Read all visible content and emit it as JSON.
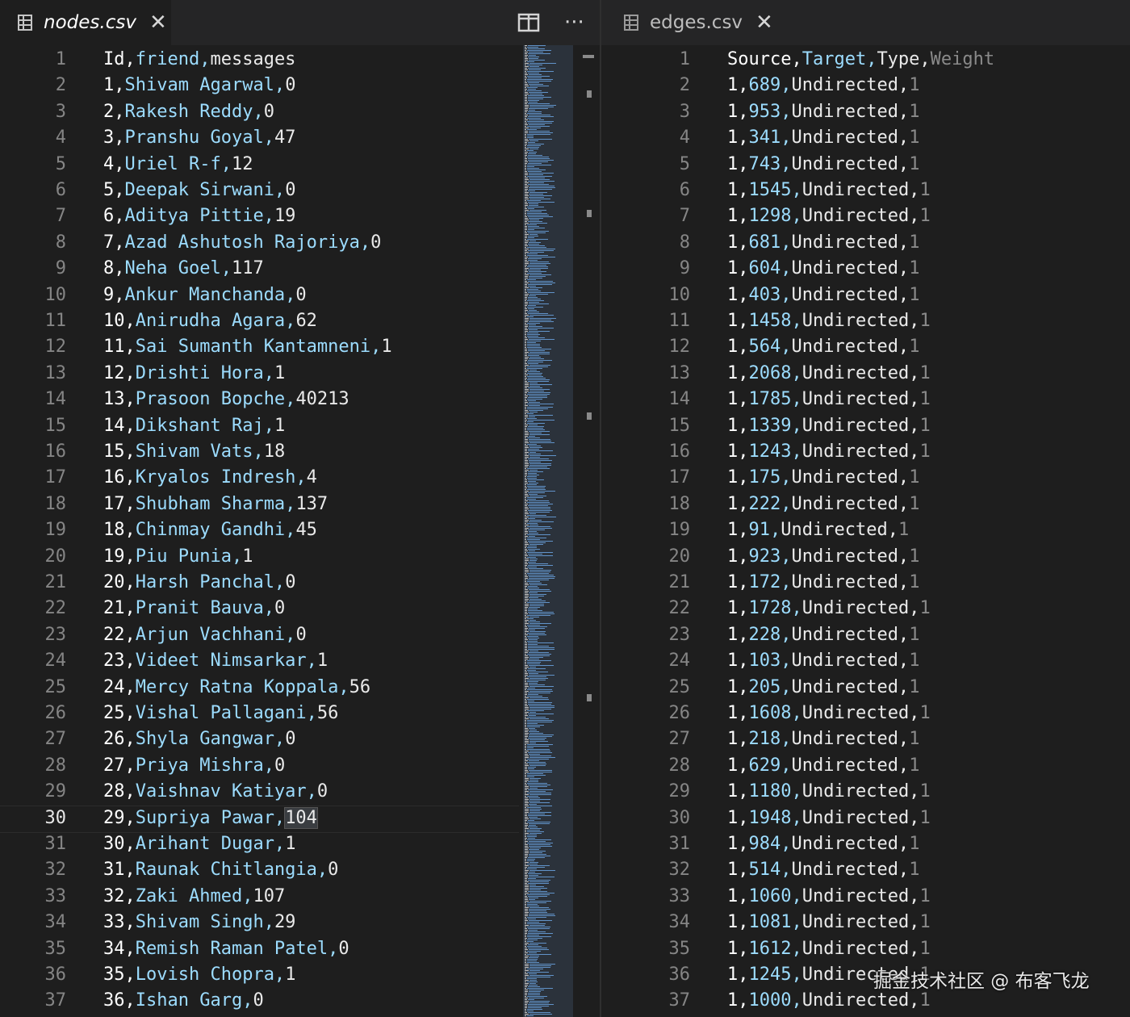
{
  "left_editor": {
    "tab": {
      "title": "nodes.csv",
      "close_glyph": "✕",
      "icon": "table-file-icon"
    },
    "actions": {
      "split_icon": "split-editor-icon",
      "more_glyph": "···"
    },
    "current_line_index": 29,
    "lines": [
      [
        "Id,",
        "friend,",
        "messages",
        ""
      ],
      [
        "1,",
        "Shivam Agarwal,",
        "0",
        ""
      ],
      [
        "2,",
        "Rakesh Reddy,",
        "0",
        ""
      ],
      [
        "3,",
        "Pranshu Goyal,",
        "47",
        ""
      ],
      [
        "4,",
        "Uriel R-f,",
        "12",
        ""
      ],
      [
        "5,",
        "Deepak Sirwani,",
        "0",
        ""
      ],
      [
        "6,",
        "Aditya Pittie,",
        "19",
        ""
      ],
      [
        "7,",
        "Azad Ashutosh Rajoriya,",
        "0",
        ""
      ],
      [
        "8,",
        "Neha Goel,",
        "117",
        ""
      ],
      [
        "9,",
        "Ankur Manchanda,",
        "0",
        ""
      ],
      [
        "10,",
        "Anirudha Agara,",
        "62",
        ""
      ],
      [
        "11,",
        "Sai Sumanth Kantamneni,",
        "1",
        ""
      ],
      [
        "12,",
        "Drishti Hora,",
        "1",
        ""
      ],
      [
        "13,",
        "Prasoon Bopche,",
        "40213",
        ""
      ],
      [
        "14,",
        "Dikshant Raj,",
        "1",
        ""
      ],
      [
        "15,",
        "Shivam Vats,",
        "18",
        ""
      ],
      [
        "16,",
        "Kryalos Indresh,",
        "4",
        ""
      ],
      [
        "17,",
        "Shubham Sharma,",
        "137",
        ""
      ],
      [
        "18,",
        "Chinmay Gandhi,",
        "45",
        ""
      ],
      [
        "19,",
        "Piu Punia,",
        "1",
        ""
      ],
      [
        "20,",
        "Harsh Panchal,",
        "0",
        ""
      ],
      [
        "21,",
        "Pranit Bauva,",
        "0",
        ""
      ],
      [
        "22,",
        "Arjun Vachhani,",
        "0",
        ""
      ],
      [
        "23,",
        "Videet Nimsarkar,",
        "1",
        ""
      ],
      [
        "24,",
        "Mercy Ratna Koppala,",
        "56",
        ""
      ],
      [
        "25,",
        "Vishal Pallagani,",
        "56",
        ""
      ],
      [
        "26,",
        "Shyla Gangwar,",
        "0",
        ""
      ],
      [
        "27,",
        "Priya Mishra,",
        "0",
        ""
      ],
      [
        "28,",
        "Vaishnav Katiyar,",
        "0",
        ""
      ],
      [
        "29,",
        "Supriya Pawar,",
        "104",
        ""
      ],
      [
        "30,",
        "Arihant Dugar,",
        "1",
        ""
      ],
      [
        "31,",
        "Raunak Chitlangia,",
        "0",
        ""
      ],
      [
        "32,",
        "Zaki Ahmed,",
        "107",
        ""
      ],
      [
        "33,",
        "Shivam Singh,",
        "29",
        ""
      ],
      [
        "34,",
        "Remish Raman Patel,",
        "0",
        ""
      ],
      [
        "35,",
        "Lovish Chopra,",
        "1",
        ""
      ],
      [
        "36,",
        "Ishan Garg,",
        "0",
        ""
      ]
    ]
  },
  "right_editor": {
    "tab": {
      "title": "edges.csv",
      "close_glyph": "✕",
      "icon": "table-file-icon"
    },
    "lines": [
      [
        "Source,",
        "Target,",
        "Type,",
        "Weight"
      ],
      [
        "1,",
        "689,",
        "Undirected,",
        "1"
      ],
      [
        "1,",
        "953,",
        "Undirected,",
        "1"
      ],
      [
        "1,",
        "341,",
        "Undirected,",
        "1"
      ],
      [
        "1,",
        "743,",
        "Undirected,",
        "1"
      ],
      [
        "1,",
        "1545,",
        "Undirected,",
        "1"
      ],
      [
        "1,",
        "1298,",
        "Undirected,",
        "1"
      ],
      [
        "1,",
        "681,",
        "Undirected,",
        "1"
      ],
      [
        "1,",
        "604,",
        "Undirected,",
        "1"
      ],
      [
        "1,",
        "403,",
        "Undirected,",
        "1"
      ],
      [
        "1,",
        "1458,",
        "Undirected,",
        "1"
      ],
      [
        "1,",
        "564,",
        "Undirected,",
        "1"
      ],
      [
        "1,",
        "2068,",
        "Undirected,",
        "1"
      ],
      [
        "1,",
        "1785,",
        "Undirected,",
        "1"
      ],
      [
        "1,",
        "1339,",
        "Undirected,",
        "1"
      ],
      [
        "1,",
        "1243,",
        "Undirected,",
        "1"
      ],
      [
        "1,",
        "175,",
        "Undirected,",
        "1"
      ],
      [
        "1,",
        "222,",
        "Undirected,",
        "1"
      ],
      [
        "1,",
        "91,",
        "Undirected,",
        "1"
      ],
      [
        "1,",
        "923,",
        "Undirected,",
        "1"
      ],
      [
        "1,",
        "172,",
        "Undirected,",
        "1"
      ],
      [
        "1,",
        "1728,",
        "Undirected,",
        "1"
      ],
      [
        "1,",
        "228,",
        "Undirected,",
        "1"
      ],
      [
        "1,",
        "103,",
        "Undirected,",
        "1"
      ],
      [
        "1,",
        "205,",
        "Undirected,",
        "1"
      ],
      [
        "1,",
        "1608,",
        "Undirected,",
        "1"
      ],
      [
        "1,",
        "218,",
        "Undirected,",
        "1"
      ],
      [
        "1,",
        "629,",
        "Undirected,",
        "1"
      ],
      [
        "1,",
        "1180,",
        "Undirected,",
        "1"
      ],
      [
        "1,",
        "1948,",
        "Undirected,",
        "1"
      ],
      [
        "1,",
        "984,",
        "Undirected,",
        "1"
      ],
      [
        "1,",
        "514,",
        "Undirected,",
        "1"
      ],
      [
        "1,",
        "1060,",
        "Undirected,",
        "1"
      ],
      [
        "1,",
        "1081,",
        "Undirected,",
        "1"
      ],
      [
        "1,",
        "1612,",
        "Undirected,",
        "1"
      ],
      [
        "1,",
        "1245,",
        "Undirected,",
        "1"
      ],
      [
        "1,",
        "1000,",
        "Undirected,",
        "1"
      ]
    ]
  },
  "watermark": "掘金技术社区 @ 布客飞龙",
  "colors": {
    "background": "#1e1e1e",
    "tabbar": "#252526",
    "column1": "#ffffff",
    "column2": "#9cdcfe",
    "column3": "#eaeaea",
    "column4": "#8a8a8a",
    "line_number": "#858585"
  }
}
